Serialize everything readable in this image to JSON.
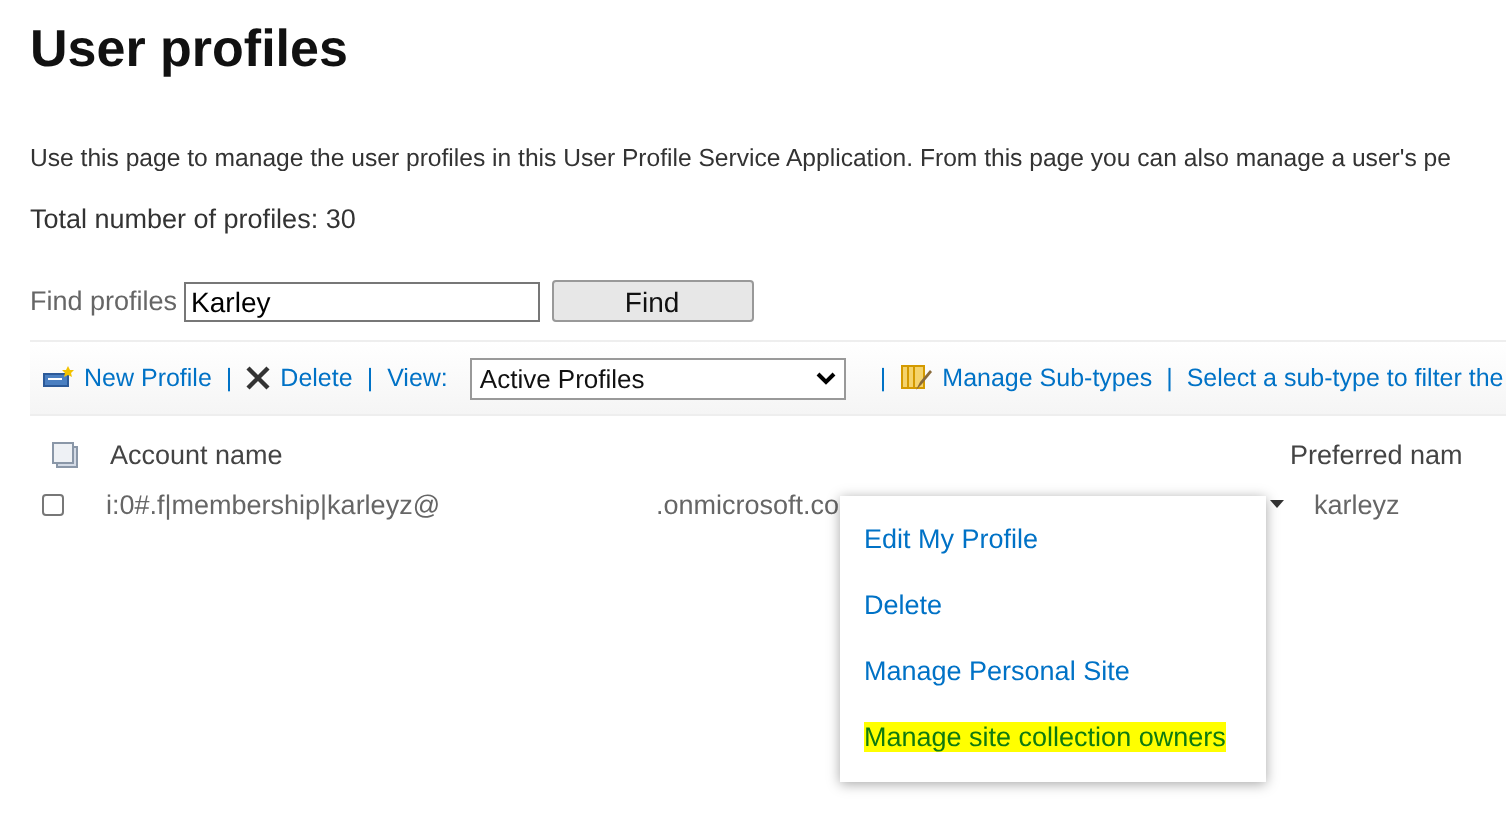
{
  "page": {
    "title": "User profiles",
    "description": "Use this page to manage the user profiles in this User Profile Service Application. From this page you can also manage a user's pe",
    "total": "Total number of profiles: 30"
  },
  "search": {
    "label": "Find profiles",
    "value": "Karley",
    "button": "Find"
  },
  "toolbar": {
    "new_profile": "New Profile",
    "delete": "Delete",
    "view_label": "View:",
    "view_value": "Active Profiles",
    "manage_subtypes": "Manage Sub-types",
    "filter_hint": "Select a sub-type to filter the",
    "separators": [
      "|",
      "|",
      "|",
      "|"
    ]
  },
  "table": {
    "columns": [
      "Account name",
      "Preferred nam"
    ],
    "rows": [
      {
        "checked": false,
        "account_start": "i:0#.f|membership|karleyz@",
        "account_end": ".onmicrosoft.co",
        "preferred_name": "karleyz"
      }
    ]
  },
  "context_menu": {
    "items": [
      {
        "label": "Edit My Profile",
        "highlighted": false
      },
      {
        "label": "Delete",
        "highlighted": false
      },
      {
        "label": "Manage Personal Site",
        "highlighted": false
      },
      {
        "label": "Manage site collection owners",
        "highlighted": true
      }
    ]
  }
}
